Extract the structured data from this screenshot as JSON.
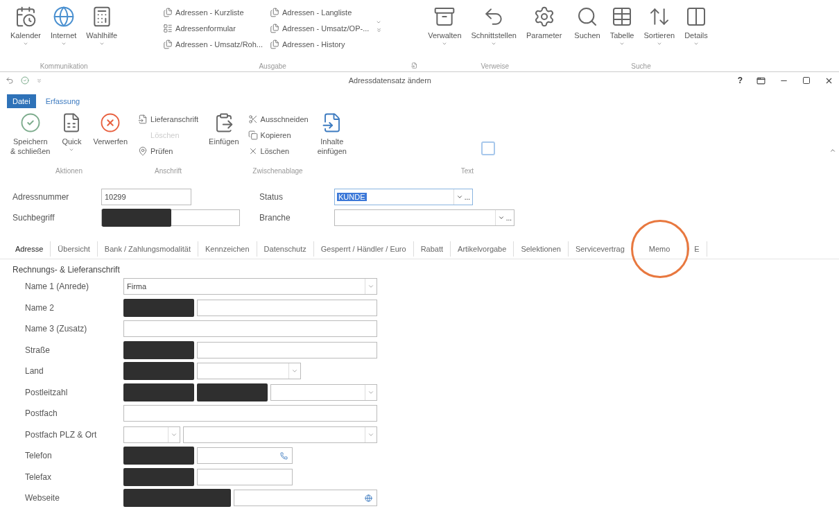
{
  "top_ribbon": {
    "groups": [
      {
        "label": "Kommunikation",
        "items": [
          {
            "kind": "large",
            "label": "Kalender",
            "dropdown": true
          },
          {
            "kind": "large",
            "label": "Internet",
            "dropdown": true
          },
          {
            "kind": "large",
            "label": "Wahlhilfe",
            "dropdown": true
          }
        ]
      },
      {
        "label": "Ausgabe",
        "launcher": true,
        "items": [
          {
            "kind": "small",
            "label": "Adressen - Kurzliste"
          },
          {
            "kind": "small",
            "label": "Adressenformular"
          },
          {
            "kind": "small",
            "label": "Adressen - Umsatz/Roh..."
          },
          {
            "kind": "small",
            "label": "Adressen - Langliste"
          },
          {
            "kind": "small",
            "label": "Adressen - Umsatz/OP-..."
          },
          {
            "kind": "small",
            "label": "Adressen - History"
          }
        ]
      },
      {
        "label": "Verweise",
        "items": [
          {
            "kind": "large",
            "label": "Verwalten",
            "dropdown": true
          },
          {
            "kind": "large",
            "label": "Schnittstellen",
            "dropdown": true
          },
          {
            "kind": "large",
            "label": "Parameter",
            "dropdown": false
          }
        ]
      },
      {
        "label": "Suche",
        "items": [
          {
            "kind": "large",
            "label": "Suchen",
            "dropdown": false
          },
          {
            "kind": "large",
            "label": "Tabelle",
            "dropdown": true
          },
          {
            "kind": "large",
            "label": "Sortieren",
            "dropdown": true
          },
          {
            "kind": "large",
            "label": "Details",
            "dropdown": true
          }
        ]
      }
    ]
  },
  "window": {
    "title": "Adressdatensatz ändern",
    "help": "?"
  },
  "tabs": [
    {
      "label": "Datei",
      "selected": true
    },
    {
      "label": "Erfassung",
      "selected": false
    }
  ],
  "ribbon": {
    "groups": [
      {
        "label": "Aktionen",
        "items": [
          {
            "kind": "large",
            "label": "Speichern\n& schließen",
            "dropdown": false,
            "disabled": false
          },
          {
            "kind": "large",
            "label": "Quick",
            "dropdown": true,
            "disabled": false
          },
          {
            "kind": "large",
            "label": "Verwerfen",
            "dropdown": false,
            "disabled": false
          }
        ]
      },
      {
        "label": "Anschrift",
        "items": [
          {
            "kind": "small",
            "label": "Lieferanschrift",
            "disabled": false
          },
          {
            "kind": "small",
            "label": "Löschen",
            "disabled": true
          },
          {
            "kind": "small",
            "label": "Prüfen",
            "disabled": false
          }
        ]
      },
      {
        "label": "Zwischenablage",
        "items": [
          {
            "kind": "large",
            "label": "Einfügen",
            "dropdown": false,
            "disabled": false
          },
          {
            "kind": "small",
            "label": "Ausschneiden",
            "disabled": false
          },
          {
            "kind": "small",
            "label": "Kopieren",
            "disabled": false
          },
          {
            "kind": "small",
            "label": "Löschen",
            "disabled": false
          },
          {
            "kind": "large",
            "label": "Inhalte\neinfügen",
            "dropdown": false,
            "disabled": false
          }
        ]
      },
      {
        "label": "Text"
      }
    ]
  },
  "header_fields": [
    {
      "label": "Adressnummer",
      "kind": "text",
      "value": "10299",
      "redacted": false,
      "highlighted": false
    },
    {
      "label": "Status",
      "kind": "lookup",
      "value": "KUNDE",
      "button": "...",
      "redacted": false,
      "highlighted": true
    },
    {
      "label": "Suchbegriff",
      "kind": "text",
      "redacted": true,
      "highlighted": false
    },
    {
      "label": "Branche",
      "kind": "lookup",
      "button": "...",
      "redacted": false,
      "highlighted": false
    }
  ],
  "record_tabs": [
    {
      "label": "Adresse",
      "selected": true,
      "circled": false
    },
    {
      "label": "Übersicht",
      "selected": false,
      "circled": false
    },
    {
      "label": "Bank / Zahlungsmodalität",
      "selected": false,
      "circled": false
    },
    {
      "label": "Kennzeichen",
      "selected": false,
      "circled": false
    },
    {
      "label": "Datenschutz",
      "selected": false,
      "circled": false
    },
    {
      "label": "Gesperrt / Händler / Euro",
      "selected": false,
      "circled": false
    },
    {
      "label": "Rabatt",
      "selected": false,
      "circled": false
    },
    {
      "label": "Artikelvorgabe",
      "selected": false,
      "circled": false
    },
    {
      "label": "Selektionen",
      "selected": false,
      "circled": false
    },
    {
      "label": "Servicevertrag",
      "selected": false,
      "circled": false
    },
    {
      "label": "Memo",
      "selected": false,
      "circled": true
    },
    {
      "label": "E",
      "selected": false,
      "circled": false
    }
  ],
  "section": {
    "title": "Rechnungs- & Lieferanschrift",
    "rows": [
      {
        "label": "Name 1 (Anrede)",
        "kind": "select",
        "value": "Firma",
        "redacted": false
      },
      {
        "label": "Name 2",
        "kind": "text",
        "redacted": true
      },
      {
        "label": "Name 3 (Zusatz)",
        "kind": "text",
        "redacted": false
      },
      {
        "label": "Straße",
        "kind": "text",
        "redacted": true
      },
      {
        "label": "Land",
        "kind": "short-select",
        "redacted": true
      },
      {
        "label": "Postleitzahl",
        "kind": "zip",
        "redacted": true
      },
      {
        "label": "Postfach",
        "kind": "text",
        "redacted": false
      },
      {
        "label": "Postfach PLZ & Ort",
        "kind": "dual-select",
        "redacted": false
      },
      {
        "label": "Telefon",
        "kind": "phone",
        "redacted": true
      },
      {
        "label": "Telefax",
        "kind": "short-text",
        "redacted": true
      },
      {
        "label": "Webseite",
        "kind": "web",
        "redacted": true
      }
    ]
  }
}
